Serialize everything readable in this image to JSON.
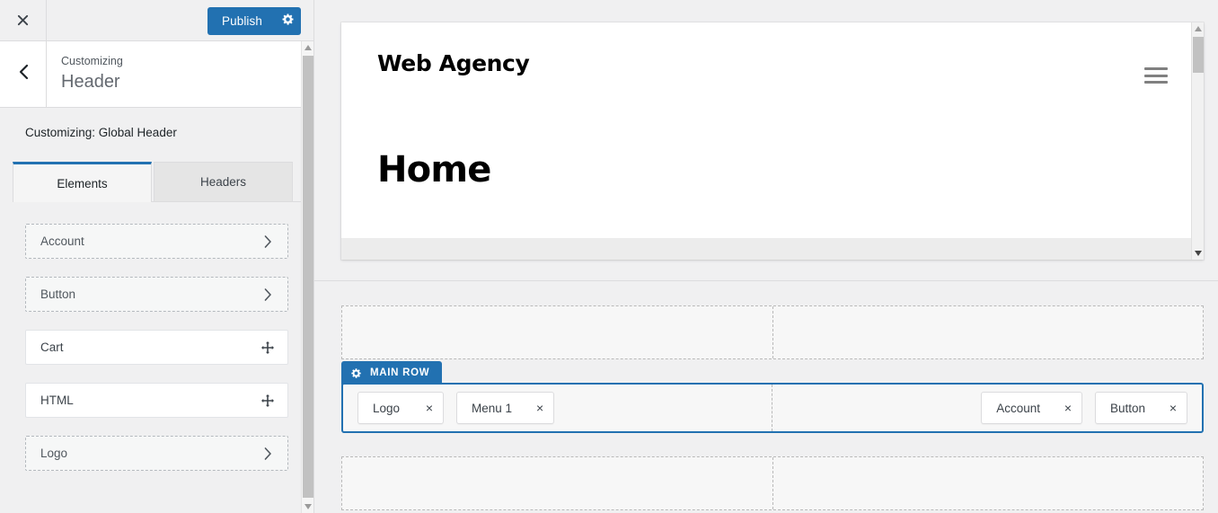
{
  "customizer": {
    "close_label": "Close customizer",
    "publish_label": "Publish",
    "publish_settings_label": "Publish settings",
    "back_label": "Back",
    "breadcrumb_sub": "Customizing",
    "breadcrumb_title": "Header",
    "panel_label": "Customizing: Global Header",
    "tabs": [
      {
        "label": "Elements",
        "active": true
      },
      {
        "label": "Headers",
        "active": false
      }
    ],
    "elements": [
      {
        "label": "Account",
        "icon": "chevron-right-icon",
        "style": "dashed"
      },
      {
        "label": "Button",
        "icon": "chevron-right-icon",
        "style": "dashed"
      },
      {
        "label": "Cart",
        "icon": "move-icon",
        "style": "solid"
      },
      {
        "label": "HTML",
        "icon": "move-icon",
        "style": "solid"
      },
      {
        "label": "Logo",
        "icon": "chevron-right-icon",
        "style": "dashed"
      }
    ]
  },
  "preview": {
    "site_logo": "Web Agency",
    "page_title": "Home",
    "menu_toggle_label": "Menu"
  },
  "builder": {
    "row_tab_label": "MAIN ROW",
    "top_row": {
      "left_items": [],
      "right_items": []
    },
    "main_row": {
      "left_items": [
        {
          "label": "Logo",
          "remove": "×"
        },
        {
          "label": "Menu 1",
          "remove": "×"
        }
      ],
      "right_items": [
        {
          "label": "Account",
          "remove": "×"
        },
        {
          "label": "Button",
          "remove": "×"
        }
      ]
    },
    "bottom_row": {
      "left_items": [],
      "right_items": []
    }
  },
  "colors": {
    "accent": "#2271b1",
    "panel_bg": "#f0f0f1",
    "row_bg": "#f7f7f7",
    "dashed_border": "#b9b9b9",
    "text": "#3c434a"
  }
}
